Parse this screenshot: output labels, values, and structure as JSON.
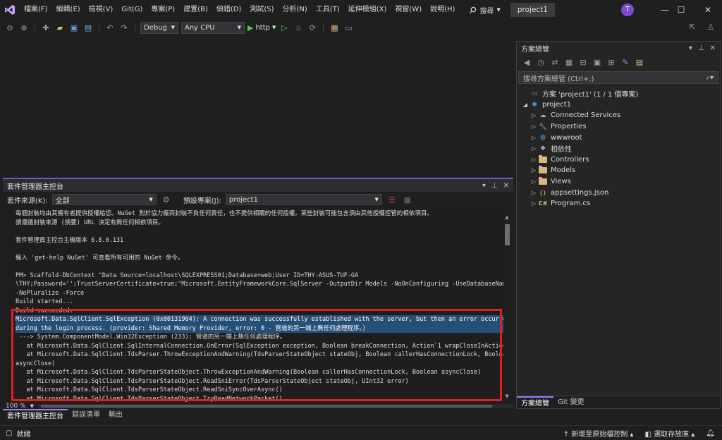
{
  "menu": {
    "items": [
      "檔案(F)",
      "編輯(E)",
      "檢視(V)",
      "Git(G)",
      "專案(P)",
      "建置(B)",
      "偵錯(D)",
      "測試(S)",
      "分析(N)",
      "工具(T)",
      "延伸模組(X)",
      "視窗(W)",
      "說明(H)"
    ],
    "search_label": "搜尋",
    "project_name": "project1",
    "avatar_initial": "T"
  },
  "toolbar": {
    "config": "Debug",
    "platform": "Any CPU",
    "run_target": "http"
  },
  "solution_explorer": {
    "title": "方案總管",
    "search_placeholder": "搜尋方案總管 (Ctrl+;)",
    "solution_label": "方案 'project1' (1 / 1 個專案)",
    "project": "project1",
    "items": [
      {
        "label": "Connected Services",
        "icon": "connected-services-icon"
      },
      {
        "label": "Properties",
        "icon": "wrench-icon"
      },
      {
        "label": "wwwroot",
        "icon": "globe-icon"
      },
      {
        "label": "相依性",
        "icon": "dependencies-icon"
      },
      {
        "label": "Controllers",
        "icon": "folder-icon"
      },
      {
        "label": "Models",
        "icon": "folder-icon"
      },
      {
        "label": "Views",
        "icon": "folder-icon"
      },
      {
        "label": "appsettings.json",
        "icon": "json-file-icon"
      },
      {
        "label": "Program.cs",
        "icon": "csharp-file-icon"
      }
    ],
    "bottom_tabs": [
      "方案總管",
      "Git 變更"
    ]
  },
  "pmc": {
    "title": "套件管理器主控台",
    "source_label": "套件來源(K):",
    "source_value": "全部",
    "default_project_label": "預設專案(J):",
    "default_project_value": "project1",
    "zoom": "100 %",
    "lines": [
      "每個封裝均由其擁有者提供授權給您。NuGet 對於協力廠商封裝不負任何責任，也不提供相關的任何授權。某些封裝可能包含須由其他授權控管的相依項目。",
      "請遵循封裝來源 (摘要) URL 決定有無任何相依項目。",
      "",
      "套件管理員主控台主機版本 6.8.0.131",
      "",
      "輸入 'get-help NuGet' 可查看所有可用的 NuGet 命令。",
      "",
      "PM> Scaffold-DbContext \"Data Source=localhost\\SQLEXPRESS01;Database=web;User ID=THY-ASUS-TUF-GA",
      "\\THY;Password='';TrustServerCertificate=true;\"Microsoft.EntityFrameworkCore.SqlServer -OutputDir Models -NoOnConfiguring -UseDatabaseNames",
      "-NoPluralize -Force",
      "Build started...",
      "Build succeeded."
    ],
    "error_lines": [
      "Microsoft.Data.SqlClient.SqlException (0x80131904): A connection was successfully established with the server, but then an error occurred",
      "during the login process. (provider: Shared Memory Provider, error: 0 - 管道的另一端上無任何處理程序。)",
      " ---> System.ComponentModel.Win32Exception (233): 管道的另一端上無任何處理程序。",
      "   at Microsoft.Data.SqlClient.SqlInternalConnection.OnError(SqlException exception, Boolean breakConnection, Action`1 wrapCloseInAction)",
      "   at Microsoft.Data.SqlClient.TdsParser.ThrowExceptionAndWarning(TdsParserStateObject stateObj, Boolean callerHasConnectionLock, Boolean",
      "asyncClose)",
      "   at Microsoft.Data.SqlClient.TdsParserStateObject.ThrowExceptionAndWarning(Boolean callerHasConnectionLock, Boolean asyncClose)",
      "   at Microsoft.Data.SqlClient.TdsParserStateObject.ReadSniError(TdsParserStateObject stateObj, UInt32 error)",
      "   at Microsoft.Data.SqlClient.TdsParserStateObject.ReadSniSyncOverAsync()",
      "   at Microsoft.Data.SqlClient.TdsParserStateObject.TryReadNetworkPacket()"
    ],
    "tabs": [
      "套件管理器主控台",
      "錯誤清單",
      "輸出"
    ]
  },
  "status": {
    "ready": "就緒",
    "add_source_control": "新增至原始檔控制",
    "select_repo": "選取存放庫"
  },
  "colors": {
    "accent": "#7357c6",
    "highlight": "#264f78",
    "error_box": "#e02020"
  }
}
